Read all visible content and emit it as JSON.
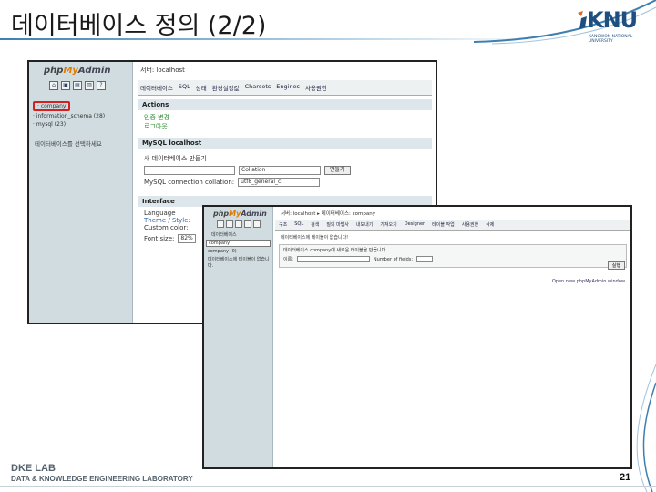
{
  "slide": {
    "title": "데이터베이스 정의 (2/2)",
    "logo_text": "KNU",
    "logo_sub": "KANGWON NATIONAL UNIVERSITY",
    "footer_lab": "DKE LAB",
    "footer_lab_full": "DATA & KNOWLEDGE ENGINEERING LABORATORY",
    "page_number": "21"
  },
  "shot1": {
    "logo_php": "php",
    "logo_my": "My",
    "logo_admin": "Admin",
    "databases": [
      "company",
      "information_schema (28)",
      "mysql (23)"
    ],
    "select_db_note": "데이터베이스를 선택하세요",
    "server": "서버: localhost",
    "tabs": [
      "데이터베이스",
      "SQL",
      "상태",
      "환경설정값",
      "Charsets",
      "Engines",
      "사용권한"
    ],
    "actions_title": "Actions",
    "actions": [
      "인증 변경",
      "로그아웃"
    ],
    "mysql_title": "MySQL localhost",
    "create_db_label": "새 데이터베이스 만들기",
    "collation_placeholder": "Collation",
    "create_button": "만들기",
    "connection_collation_label": "MySQL connection collation:",
    "connection_collation_value": "utf8_general_ci",
    "interface_title": "Interface",
    "interface_items": [
      "Language",
      "Theme / Style:",
      "Custom color:",
      "Font size:"
    ],
    "font_size_value": "82%"
  },
  "shot2": {
    "crumb": "서버: localhost ▸ 데이터베이스: company",
    "tabs": [
      "구조",
      "SQL",
      "검색",
      "질의 마법사",
      "내보내기",
      "가져오기",
      "Designer",
      "테이블 작업",
      "사용권한",
      "삭제"
    ],
    "side_label": "데이터베이스",
    "side_select": "company",
    "side_db": "company (0)",
    "side_note": "데이터베이스에 테이블이 없습니다.",
    "message": "데이터베이스에 테이블이 없습니다!",
    "create_table_label": "데이터베이스 company에 새로운 테이블을 만듭니다",
    "name_label": "이름:",
    "fields_label": "Number of fields:",
    "go_button": "실행",
    "open_link": "Open new phpMyAdmin window"
  },
  "colors": {
    "brand": "#1e4f7f",
    "highlight": "#d42020",
    "sidebar_bg": "#d0dce0"
  }
}
